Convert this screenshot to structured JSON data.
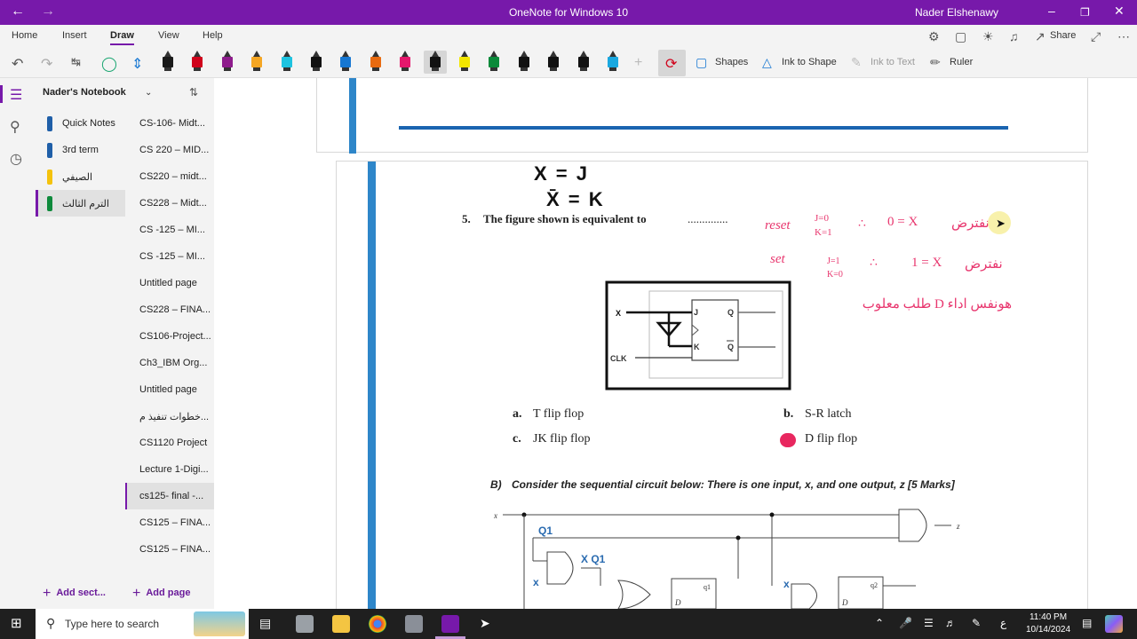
{
  "window": {
    "title": "OneNote for Windows 10",
    "user": "Nader Elshenawy",
    "back_icon": "arrow-left-icon",
    "forward_icon": "arrow-right-icon"
  },
  "menu": {
    "tabs": [
      "Home",
      "Insert",
      "Draw",
      "View",
      "Help"
    ],
    "active_tab": "Draw",
    "share_label": "Share"
  },
  "toolbar": {
    "pens": [
      {
        "color": "#1a1a1a",
        "name": "pen-black"
      },
      {
        "color": "#d0021b",
        "name": "pen-red"
      },
      {
        "color": "#8e1c8c",
        "name": "pen-purple"
      },
      {
        "color": "#f5a623",
        "name": "pen-orange"
      },
      {
        "color": "#1ec3e0",
        "name": "highlighter-cyan"
      },
      {
        "color": "#111111",
        "name": "pen-black-2"
      },
      {
        "color": "#1677d2",
        "name": "pen-blue"
      },
      {
        "color": "#e86a10",
        "name": "pen-orange-2"
      },
      {
        "color": "#e5176c",
        "name": "pen-pink"
      },
      {
        "color": "#111111",
        "name": "pen-black-selected"
      },
      {
        "color": "#f2e600",
        "name": "highlighter-yellow"
      },
      {
        "color": "#0b8a3a",
        "name": "pen-green"
      },
      {
        "color": "#111111",
        "name": "pen-black-3"
      },
      {
        "color": "#111111",
        "name": "pen-black-4"
      },
      {
        "color": "#111111",
        "name": "pen-black-5"
      },
      {
        "color": "#1aa8e0",
        "name": "pen-light-blue"
      }
    ],
    "shapes_label": "Shapes",
    "ink_to_shape_label": "Ink to Shape",
    "ink_to_text_label": "Ink to Text",
    "ruler_label": "Ruler"
  },
  "notebook": {
    "name": "Nader's Notebook",
    "sections": [
      {
        "label": "Quick Notes",
        "color": "#1f5fa8"
      },
      {
        "label": "3rd term",
        "color": "#1f5fa8"
      },
      {
        "label": "الصيفي",
        "color": "#f4c20d"
      },
      {
        "label": "الترم الثالث",
        "color": "#0f8a3c"
      }
    ],
    "active_section": 3,
    "pages": [
      "CS-106- Midt...",
      "CS 220 – MID...",
      "CS220 – midt...",
      "CS228 – Midt...",
      "CS -125 – MI...",
      "CS -125 – MI...",
      "Untitled page",
      "CS228 – FINA...",
      "CS106-Project...",
      "Ch3_IBM Org...",
      "Untitled page",
      "خطوات تنفيذ م...",
      "CS1120 Project",
      "Lecture 1-Digi...",
      "cs125- final -...",
      "CS125 – FINA...",
      "CS125 – FINA..."
    ],
    "active_page": 14,
    "add_section_label": "Add sect...",
    "add_page_label": "Add page"
  },
  "page_content": {
    "question_number": "5.",
    "question_text": "The figure shown is equivalent to",
    "blank": "..............",
    "handwritten_top_1": "X = J",
    "handwritten_top_2": "X̄ = K",
    "options": [
      {
        "letter": "a.",
        "text": "T flip flop"
      },
      {
        "letter": "b.",
        "text": "S-R latch"
      },
      {
        "letter": "c.",
        "text": "JK flip flop"
      },
      {
        "letter": "d.",
        "text": "D flip flop"
      }
    ],
    "selected_option": "d.",
    "section_b_letter": "B)",
    "section_b_text": "Consider the sequential circuit below: There is one input, x, and one output, z [5 Marks]",
    "circuit_labels": {
      "x": "X",
      "clk": "CLK",
      "j": "J",
      "k": "K",
      "q": "Q",
      "qbar": "Q̄"
    },
    "annotations": {
      "reset": "reset",
      "reset_cond_1": "J=0",
      "reset_cond_2": "K=1",
      "reset_result": "0 = X",
      "set": "set",
      "set_cond_1": "J=1",
      "set_cond_2": "K=0",
      "set_result": "1 = X",
      "arabic_1": "نفترض",
      "arabic_2": "نفترض",
      "arabic_3": "هونفس اداء D طلب معلوب"
    },
    "circuit_b_labels": {
      "x": "x",
      "z": "z",
      "q1": "Q1",
      "xq1": "X Q1",
      "d": "D",
      "q": "q1",
      "q2": "q2"
    }
  },
  "taskbar": {
    "search_placeholder": "Type here to search",
    "time": "11:40 PM",
    "date": "10/14/2024",
    "lang": "ع"
  }
}
